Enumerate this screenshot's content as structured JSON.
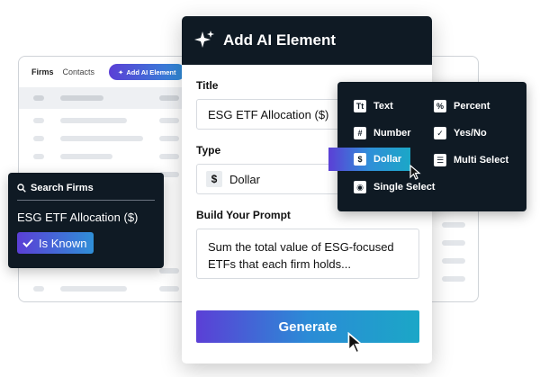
{
  "background": {
    "tabs": [
      "Firms",
      "Contacts"
    ],
    "ai_button_label": "Add AI Element"
  },
  "search_panel": {
    "title": "Search Firms",
    "value": "ESG ETF Allocation ($)",
    "badge_label": "Is Known"
  },
  "modal": {
    "title": "Add AI Element",
    "title_label": "Title",
    "title_value": "ESG ETF Allocation ($)",
    "type_label": "Type",
    "type_value": "Dollar",
    "prompt_label": "Build Your Prompt",
    "prompt_value": "Sum the total value of ESG-focused ETFs that each firm holds...",
    "generate_label": "Generate"
  },
  "type_menu": {
    "items": [
      {
        "label": "Text",
        "icon": "text-type-icon",
        "glyph": "Tt"
      },
      {
        "label": "Percent",
        "icon": "percent-icon",
        "glyph": "%"
      },
      {
        "label": "Number",
        "icon": "number-icon",
        "glyph": "#"
      },
      {
        "label": "Yes/No",
        "icon": "checkbox-icon",
        "glyph": "✓"
      },
      {
        "label": "Dollar",
        "icon": "dollar-icon",
        "glyph": "$"
      },
      {
        "label": "Multi Select",
        "icon": "list-icon",
        "glyph": "☰"
      },
      {
        "label": "Single Select",
        "icon": "radio-icon",
        "glyph": "◉"
      }
    ],
    "selected": "Dollar"
  },
  "colors": {
    "dark_panel": "#0f1a24",
    "accent_start": "#5b3fd6",
    "accent_end": "#1ba7c7"
  }
}
